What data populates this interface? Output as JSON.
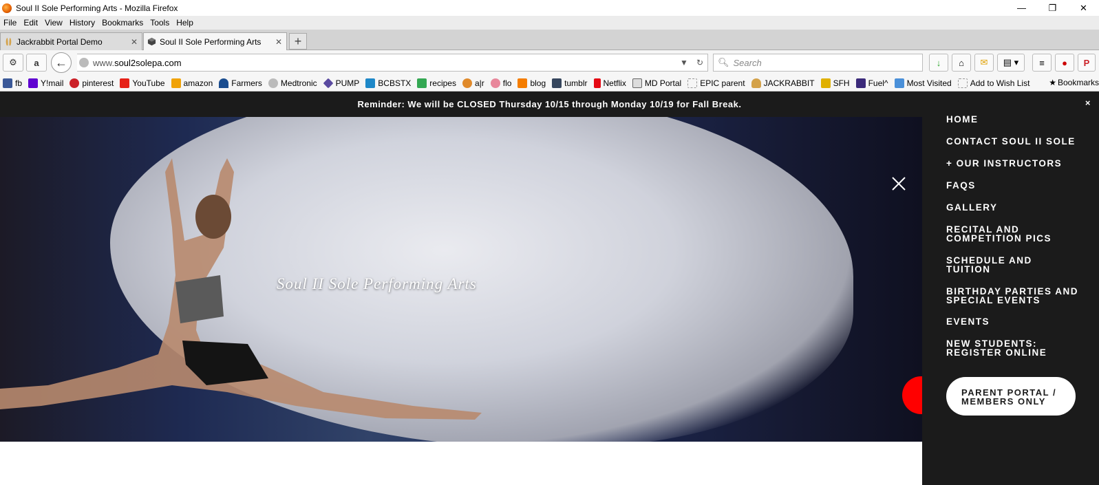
{
  "window": {
    "title": "Soul II Sole Performing Arts - Mozilla Firefox",
    "controls": {
      "minimize": "—",
      "restore": "❐",
      "close": "✕"
    }
  },
  "menubar": [
    "File",
    "Edit",
    "View",
    "History",
    "Bookmarks",
    "Tools",
    "Help"
  ],
  "tabs": [
    {
      "label": "Jackrabbit Portal Demo",
      "active": false
    },
    {
      "label": "Soul II Sole Performing Arts",
      "active": true
    }
  ],
  "new_tab_label": "+",
  "address": {
    "prefix": "www.",
    "domain": "soul2solepa.com"
  },
  "search": {
    "placeholder": "Search"
  },
  "bookmarks": [
    {
      "label": "fb",
      "icon": "facebook-icon",
      "color": "#3b5998"
    },
    {
      "label": "Y!mail",
      "icon": "yahoo-icon",
      "color": "#5f01d1"
    },
    {
      "label": "pinterest",
      "icon": "pinterest-icon",
      "color": "#cb2027"
    },
    {
      "label": "YouTube",
      "icon": "youtube-icon",
      "color": "#e62117"
    },
    {
      "label": "amazon",
      "icon": "amazon-icon",
      "color": "#f0a30a"
    },
    {
      "label": "Farmers",
      "icon": "farmers-icon",
      "color": "#1b4d8f"
    },
    {
      "label": "Medtronic",
      "icon": "medtronic-icon",
      "color": "#7a7a7a"
    },
    {
      "label": "PUMP",
      "icon": "pump-icon",
      "color": "#5a4aa0"
    },
    {
      "label": "BCBSTX",
      "icon": "bcbs-icon",
      "color": "#1e88c8"
    },
    {
      "label": "recipes",
      "icon": "recipes-icon",
      "color": "#34a853"
    },
    {
      "label": "a|r",
      "icon": "ar-icon",
      "color": "#e08a2b"
    },
    {
      "label": "flo",
      "icon": "flo-icon",
      "color": "#e8879b"
    },
    {
      "label": "blog",
      "icon": "blogger-icon",
      "color": "#f57d00"
    },
    {
      "label": "tumblr",
      "icon": "tumblr-icon",
      "color": "#36465d"
    },
    {
      "label": "Netflix",
      "icon": "netflix-icon",
      "color": "#e50914"
    },
    {
      "label": "MD Portal",
      "icon": "md-portal-icon",
      "color": "#666666"
    },
    {
      "label": "EPIC parent",
      "icon": "epic-icon",
      "color": "#999999"
    },
    {
      "label": "JACKRABBIT",
      "icon": "jackrabbit-icon",
      "color": "#d4a24a"
    },
    {
      "label": "SFH",
      "icon": "sfh-icon",
      "color": "#e0b000"
    },
    {
      "label": "Fuel^",
      "icon": "fuel-icon",
      "color": "#3b2a7a"
    },
    {
      "label": "Most Visited",
      "icon": "most-visited-icon",
      "color": "#4a90d9"
    },
    {
      "label": "Add to Wish List",
      "icon": "wishlist-icon",
      "color": "#999999"
    }
  ],
  "bookmarks_menu_label": "Bookmarks",
  "page": {
    "banner": "Reminder: We will be CLOSED Thursday 10/15 through Monday 10/19 for Fall Break.",
    "banner_close": "×",
    "hero_title": "Soul II Sole Performing Arts",
    "nav": [
      "HOME",
      "CONTACT SOUL II SOLE",
      "+ OUR INSTRUCTORS",
      "FAQS",
      "GALLERY",
      "RECITAL AND COMPETITION PICS",
      "SCHEDULE AND TUITION",
      "BIRTHDAY PARTIES AND SPECIAL EVENTS",
      "EVENTS",
      "NEW STUDENTS: REGISTER ONLINE"
    ],
    "portal_button": "PARENT PORTAL / MEMBERS ONLY"
  },
  "colors": {
    "banner_bg": "#1b1b1b",
    "sidenav_bg": "#1b1b1b",
    "red_dot": "#ff0000"
  }
}
